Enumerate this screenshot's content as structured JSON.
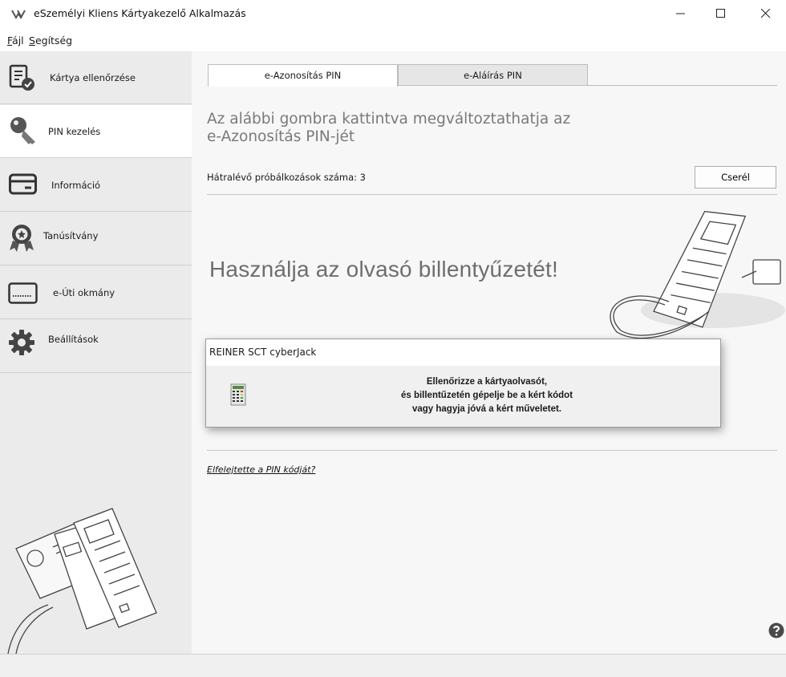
{
  "window": {
    "title": "eSzemélyi Kliens Kártyakezelő Alkalmazás"
  },
  "menu": {
    "file": {
      "accel": "F",
      "rest": "ájl"
    },
    "help": {
      "accel": "S",
      "rest": "egítség"
    }
  },
  "sidebar": {
    "items": [
      {
        "label": "Kártya ellenőrzése",
        "icon": "card-check-icon"
      },
      {
        "label": "PIN kezelés",
        "icon": "key-icon"
      },
      {
        "label": "Információ",
        "icon": "card-info-icon"
      },
      {
        "label": "Tanúsítvány",
        "icon": "certificate-icon"
      },
      {
        "label": "e-Úti okmány",
        "icon": "passport-card-icon"
      },
      {
        "label": "Beállítások",
        "icon": "gear-icon"
      }
    ],
    "active_index": 1
  },
  "tabs": [
    {
      "label": "e-Azonosítás PIN",
      "active": true
    },
    {
      "label": "e-Aláírás PIN",
      "active": false
    }
  ],
  "main": {
    "heading_line1": "Az alábbi gombra kattintva megváltoztathatja az",
    "heading_line2": "e-Azonosítás PIN-jét",
    "attempts": "Hátralévő próbálkozások száma: 3",
    "replace_button": "Cserél",
    "reader_message": "Használja az olvasó billentyűzetét!",
    "forgot_link": "Elfelejtette a PIN kódját?"
  },
  "dialog": {
    "title": "REINER SCT cyberJack",
    "line1": "Ellenőrizze a kártyaolvasót,",
    "line2": "és billentűzetén gépelje be a kért kódot",
    "line3": "vagy hagyja jóvá a kért műveletet."
  },
  "colors": {
    "sidebar_bg": "#ebebeb",
    "content_bg": "#f7f7f7",
    "heading_gray": "#7a7a7a"
  }
}
